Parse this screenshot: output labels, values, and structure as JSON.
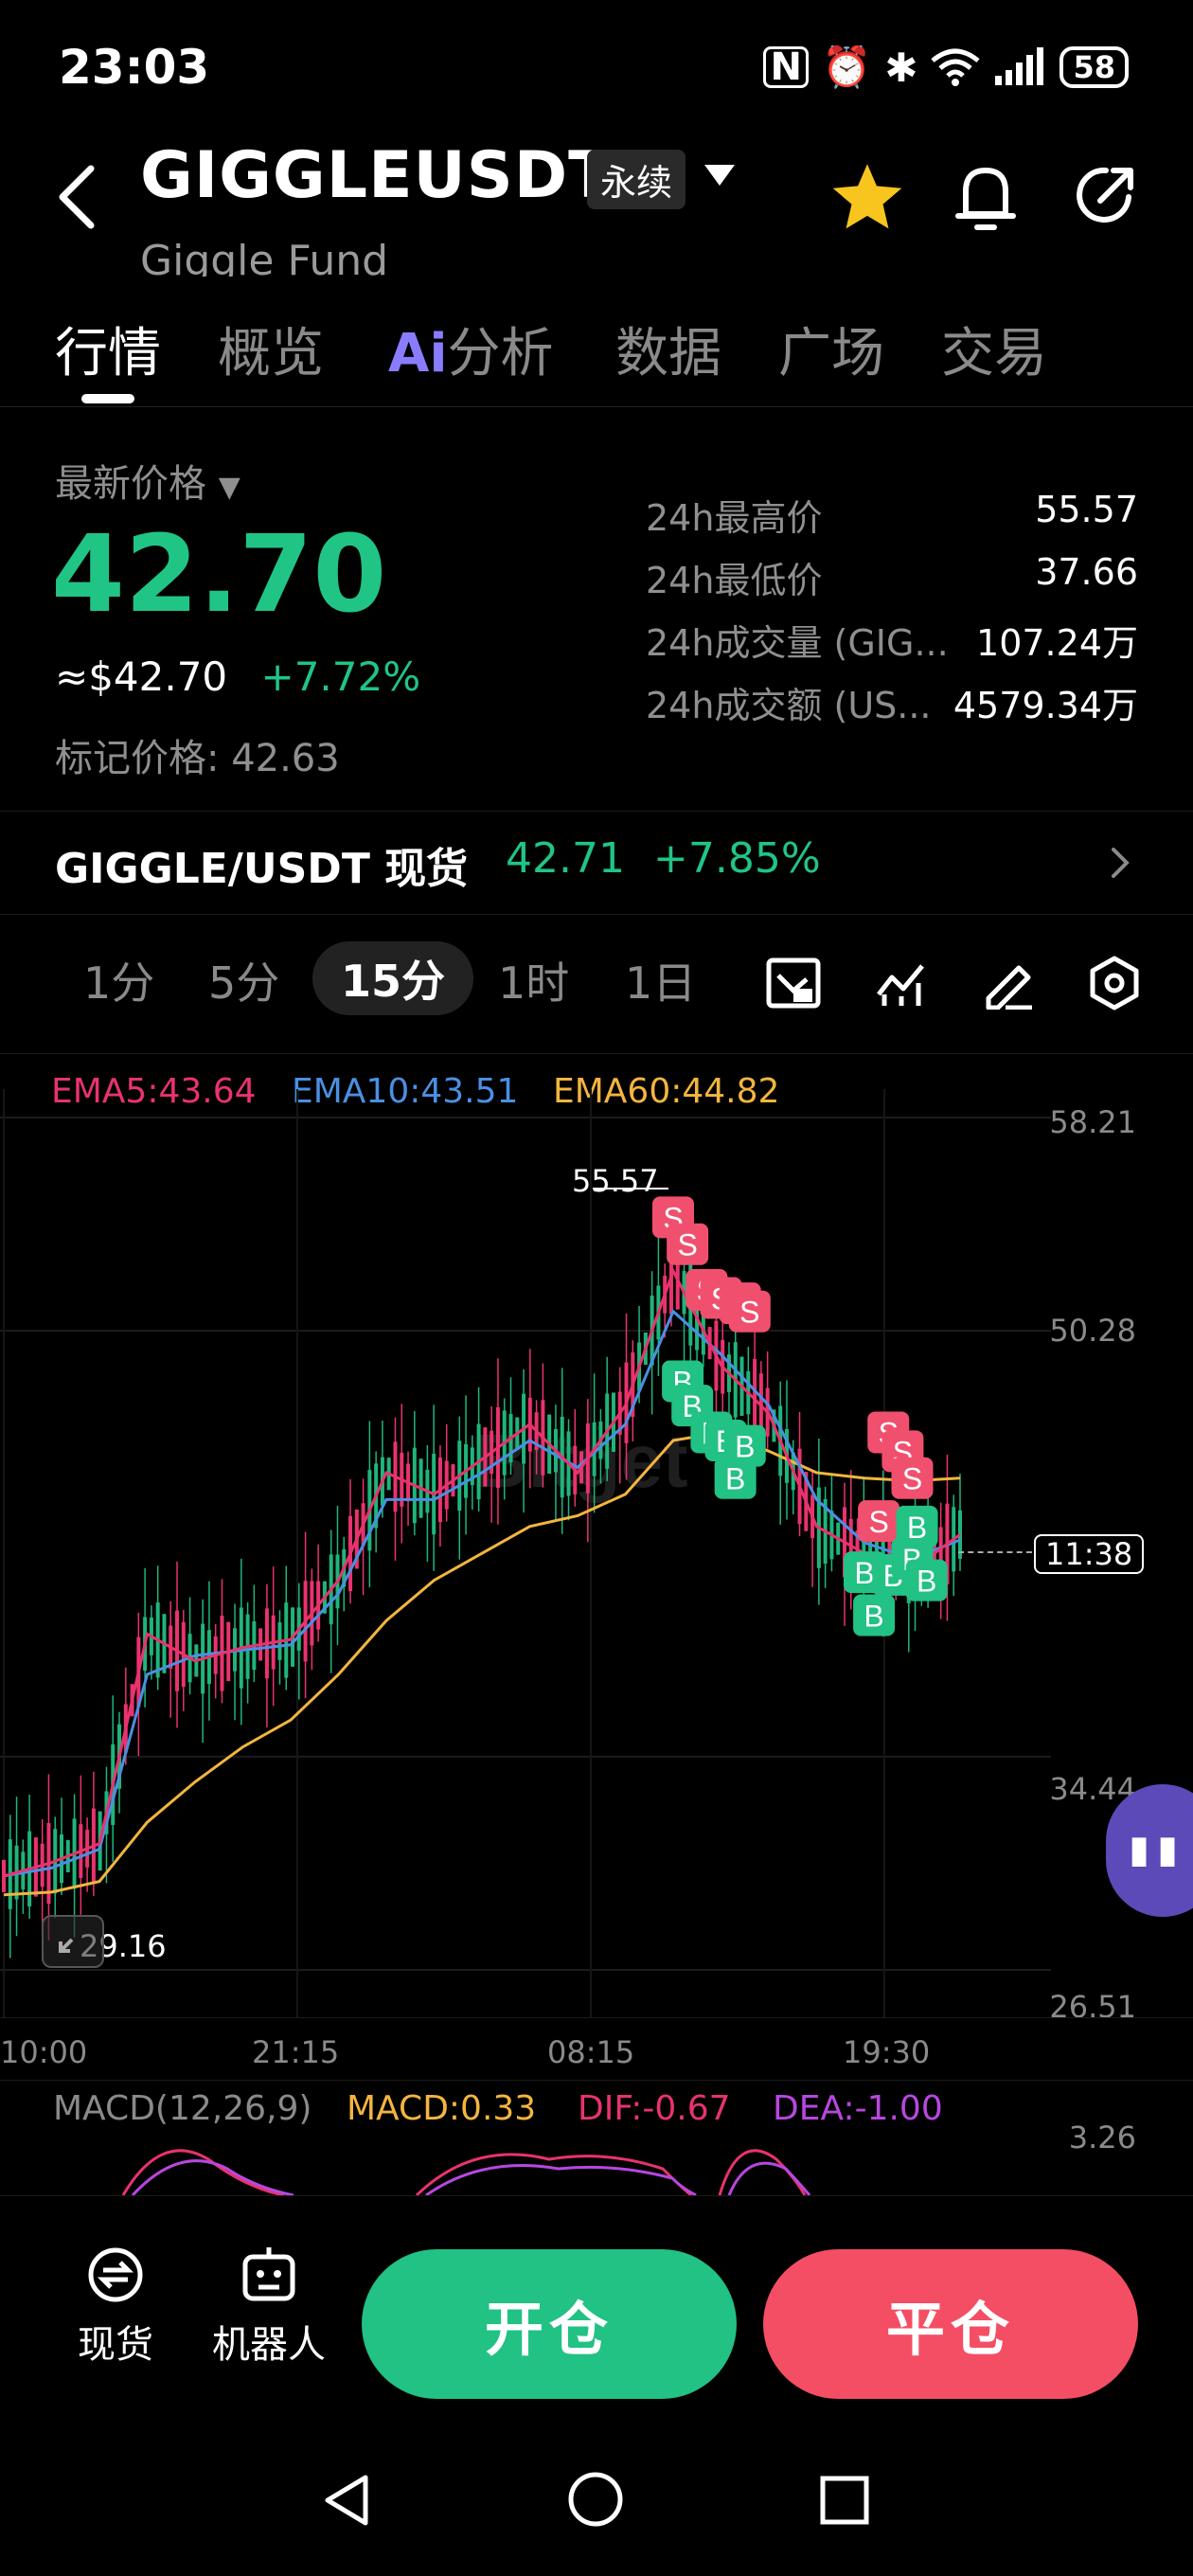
{
  "status_bar": {
    "time": "23:03",
    "battery": "58"
  },
  "header": {
    "symbol": "GIGGLEUSDT",
    "contract_tag": "永续",
    "subtitle": "Giggle Fund"
  },
  "tabs": [
    {
      "label": "行情"
    },
    {
      "label": "概览"
    },
    {
      "label": "分析",
      "ai_badge": "Ai"
    },
    {
      "label": "数据"
    },
    {
      "label": "广场"
    },
    {
      "label": "交易"
    }
  ],
  "price": {
    "label": "最新价格",
    "last": "42.70",
    "usd": "≈$42.70",
    "change": "+7.72%",
    "mark": "标记价格: 42.63"
  },
  "stats": [
    {
      "k": "24h最高价",
      "v": "55.57"
    },
    {
      "k": "24h最低价",
      "v": "37.66"
    },
    {
      "k": "24h成交量 (GIG...",
      "v": "107.24万"
    },
    {
      "k": "24h成交额 (US...",
      "v": "4579.34万"
    }
  ],
  "spot": {
    "pair": "GIGGLE/USDT 现货",
    "price": "42.71",
    "change": "+7.85%"
  },
  "timeframes": [
    "1分",
    "5分",
    "15分",
    "1时",
    "1日"
  ],
  "active_timeframe": "15分",
  "indicators": {
    "ema5": "EMA5:43.64",
    "ema10": "EMA10:43.51",
    "ema60": "EMA60:44.82"
  },
  "chart": {
    "y_labels": [
      "58.21",
      "50.28",
      "34.44",
      "26.51"
    ],
    "x_labels": [
      "10:00",
      "21:15",
      "08:15",
      "19:30"
    ],
    "high_label": "55.57",
    "low_label": "29.16",
    "countdown": "11:38",
    "watermark": "Bitget",
    "macd_label": "MACD(12,26,9)",
    "macd_value": "MACD:0.33",
    "dif": "DIF:-0.67",
    "dea": "DEA:-1.00",
    "macd_top": "3.26"
  },
  "chart_data": {
    "type": "line",
    "x_labels": [
      "10:00",
      "21:15",
      "08:15",
      "19:30"
    ],
    "ylim": [
      26.51,
      58.21
    ],
    "y_ticks": [
      58.21,
      50.28,
      34.44,
      26.51
    ],
    "series": [
      {
        "name": "EMA5",
        "color": "#e8336e",
        "values": [
          30.0,
          30.5,
          31.2,
          39.0,
          38.0,
          38.5,
          38.8,
          41.0,
          45.0,
          44.2,
          45.5,
          46.8,
          45.0,
          47.5,
          52.5,
          49.0,
          47.2,
          43.0,
          42.0,
          41.4,
          42.7
        ]
      },
      {
        "name": "EMA10",
        "color": "#4a90e2",
        "values": [
          30.0,
          30.3,
          31.0,
          37.5,
          38.2,
          38.4,
          38.6,
          40.5,
          44.0,
          44.0,
          45.0,
          46.2,
          45.2,
          46.8,
          51.0,
          49.4,
          47.5,
          44.0,
          42.4,
          41.8,
          42.5
        ]
      },
      {
        "name": "EMA60",
        "color": "#f3b53f",
        "values": [
          29.3,
          29.4,
          29.8,
          32.0,
          33.5,
          34.8,
          35.8,
          37.5,
          39.5,
          41.0,
          42.0,
          43.0,
          43.4,
          44.2,
          46.2,
          46.5,
          45.8,
          45.0,
          44.8,
          44.7,
          44.8
        ]
      }
    ],
    "markers": {
      "sell": [
        [
          14.0,
          54.5
        ],
        [
          14.3,
          53.5
        ],
        [
          14.7,
          51.8
        ],
        [
          15.0,
          51.5
        ],
        [
          15.4,
          51.3
        ],
        [
          15.6,
          51.0
        ],
        [
          18.5,
          46.5
        ],
        [
          18.8,
          45.8
        ],
        [
          19.0,
          44.8
        ],
        [
          18.3,
          43.2
        ]
      ],
      "buy": [
        [
          14.2,
          48.4
        ],
        [
          14.4,
          47.5
        ],
        [
          14.8,
          46.5
        ],
        [
          15.1,
          46.2
        ],
        [
          15.5,
          46.0
        ],
        [
          15.3,
          44.8
        ],
        [
          18.0,
          41.3
        ],
        [
          18.6,
          41.2
        ],
        [
          19.0,
          41.8
        ],
        [
          19.3,
          41.0
        ],
        [
          18.2,
          39.7
        ],
        [
          19.1,
          43.0
        ]
      ]
    },
    "high": 55.57,
    "low": 29.16,
    "last": 42.7
  },
  "bottom": {
    "spot": "现货",
    "robot": "机器人",
    "open": "开仓",
    "close": "平仓"
  }
}
